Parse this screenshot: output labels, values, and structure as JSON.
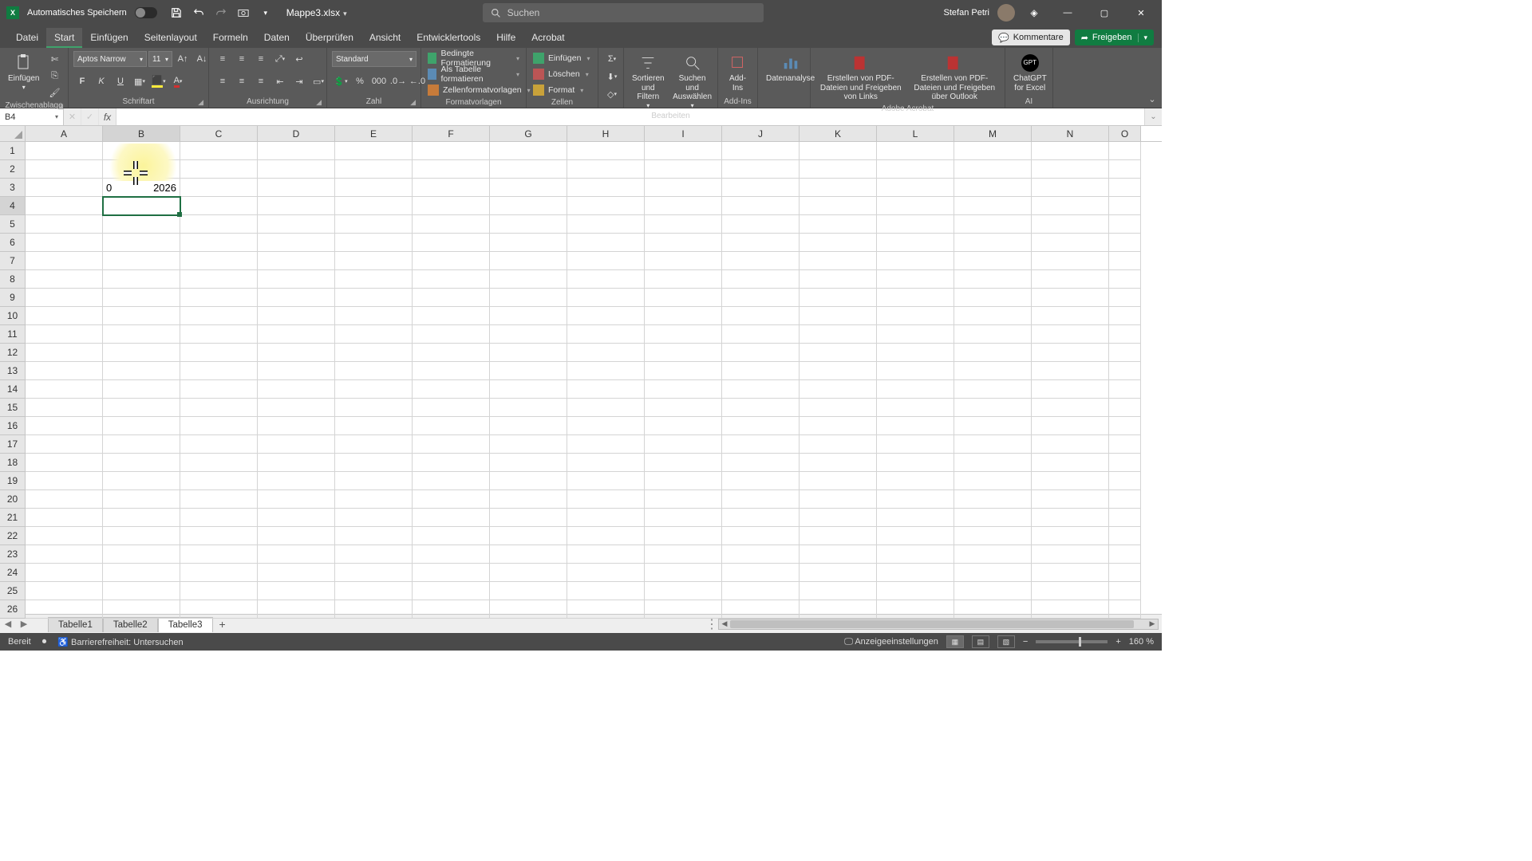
{
  "titlebar": {
    "autosave_label": "Automatisches Speichern",
    "filename": "Mappe3.xlsx",
    "search_placeholder": "Suchen",
    "user_name": "Stefan Petri"
  },
  "tabs": {
    "items": [
      "Datei",
      "Start",
      "Einfügen",
      "Seitenlayout",
      "Formeln",
      "Daten",
      "Überprüfen",
      "Ansicht",
      "Entwicklertools",
      "Hilfe",
      "Acrobat"
    ],
    "active_index": 1,
    "comments_label": "Kommentare",
    "share_label": "Freigeben"
  },
  "ribbon": {
    "clipboard": {
      "paste": "Einfügen",
      "group": "Zwischenablage"
    },
    "font": {
      "name": "Aptos Narrow",
      "size": "11",
      "group": "Schriftart"
    },
    "align": {
      "group": "Ausrichtung"
    },
    "number": {
      "format": "Standard",
      "group": "Zahl"
    },
    "styles": {
      "cond": "Bedingte Formatierung",
      "table": "Als Tabelle formatieren",
      "cell": "Zellenformatvorlagen",
      "group": "Formatvorlagen"
    },
    "cells": {
      "insert": "Einfügen",
      "delete": "Löschen",
      "format": "Format",
      "group": "Zellen"
    },
    "editing": {
      "sort": "Sortieren und Filtern",
      "find": "Suchen und Auswählen",
      "group": "Bearbeiten"
    },
    "addins": {
      "btn": "Add-Ins",
      "group": "Add-Ins"
    },
    "analysis": {
      "btn": "Datenanalyse"
    },
    "acrobat": {
      "a": "Erstellen von PDF-Dateien und Freigeben von Links",
      "b": "Erstellen von PDF-Dateien und Freigeben über Outlook",
      "group": "Adobe Acrobat"
    },
    "ai": {
      "btn": "ChatGPT for Excel",
      "group": "AI"
    }
  },
  "namebox": {
    "ref": "B4"
  },
  "grid": {
    "columns": [
      "A",
      "B",
      "C",
      "D",
      "E",
      "F",
      "G",
      "H",
      "I",
      "J",
      "K",
      "L",
      "M",
      "N",
      "O"
    ],
    "row_count": 26,
    "active_col": 1,
    "active_row": 3,
    "b3_value": "2026",
    "b3_prefix": "0"
  },
  "sheets": {
    "tabs": [
      "Tabelle1",
      "Tabelle2",
      "Tabelle3"
    ],
    "active_index": 2
  },
  "status": {
    "ready": "Bereit",
    "access": "Barrierefreiheit: Untersuchen",
    "display": "Anzeigeeinstellungen",
    "zoom": "160 %"
  }
}
